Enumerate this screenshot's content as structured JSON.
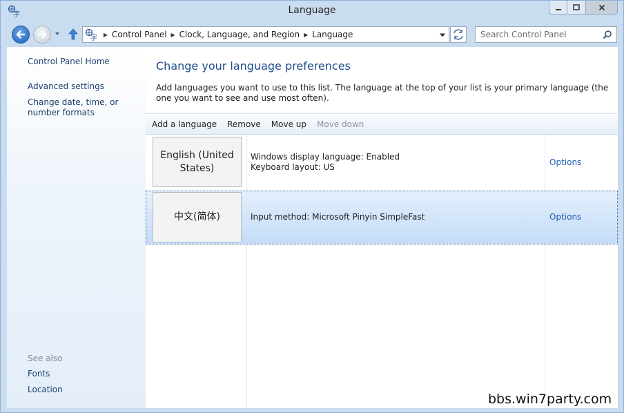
{
  "window": {
    "title": "Language"
  },
  "titlebar": {
    "icon": "language-icon",
    "controls": [
      "minimize-icon",
      "maximize-icon",
      "close-icon"
    ]
  },
  "address_bar": {
    "icon": "language-icon",
    "breadcrumbs": [
      "Control Panel",
      "Clock, Language, and Region",
      "Language"
    ]
  },
  "search": {
    "placeholder": "Search Control Panel",
    "icon": "search-icon"
  },
  "sidebar": {
    "home": "Control Panel Home",
    "links": [
      "Advanced settings",
      "Change date, time, or number formats"
    ],
    "see_also_label": "See also",
    "see_also": [
      "Fonts",
      "Location"
    ]
  },
  "main": {
    "heading": "Change your language preferences",
    "description": "Add languages you want to use to this list. The language at the top of your list is your primary language (the one you want to see and use most often).",
    "toolbar": {
      "add": "Add a language",
      "remove": "Remove",
      "move_up": "Move up",
      "move_down": "Move down"
    },
    "languages": [
      {
        "name": "English (United States)",
        "info": [
          "Windows display language: Enabled",
          "Keyboard layout: US"
        ],
        "options": "Options",
        "selected": false
      },
      {
        "name": "中文(简体)",
        "info": [
          "Input method: Microsoft Pinyin SimpleFast"
        ],
        "options": "Options",
        "selected": true
      }
    ]
  },
  "watermark": "bbs.win7party.com",
  "colors": {
    "frame": "#c9dcf0",
    "link": "#1c3f6e",
    "heading": "#1e4e8c",
    "options_link": "#1f5fb5",
    "selection": "#c4dcf8"
  }
}
